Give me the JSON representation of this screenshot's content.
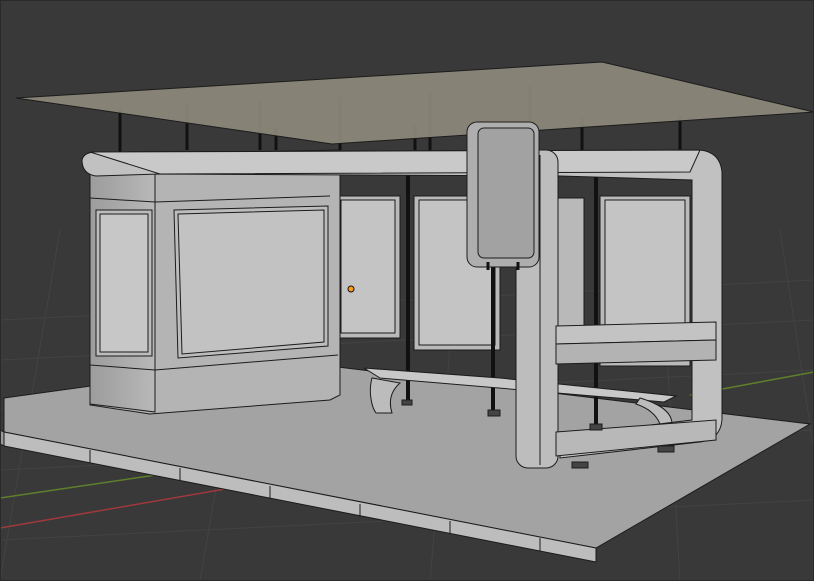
{
  "viewport": {
    "mode": "wireframe-solid",
    "colors": {
      "background": "#393939",
      "grid": "#444444",
      "axis_x": "#a0393c",
      "axis_y": "#6b8f2e",
      "mesh_face": "#b2b2b2",
      "mesh_face_dark": "#8f8f8f",
      "mesh_edge": "#1c1c1c",
      "origin": "#ff9a1a"
    }
  },
  "scene": {
    "objects": [
      {
        "name": "ground-slab"
      },
      {
        "name": "curb"
      },
      {
        "name": "roof-plane"
      },
      {
        "name": "shelter-frame"
      },
      {
        "name": "ad-kiosk"
      },
      {
        "name": "glass-panels"
      },
      {
        "name": "bench"
      },
      {
        "name": "info-sign"
      },
      {
        "name": "support-posts"
      },
      {
        "name": "object-origin"
      }
    ]
  }
}
